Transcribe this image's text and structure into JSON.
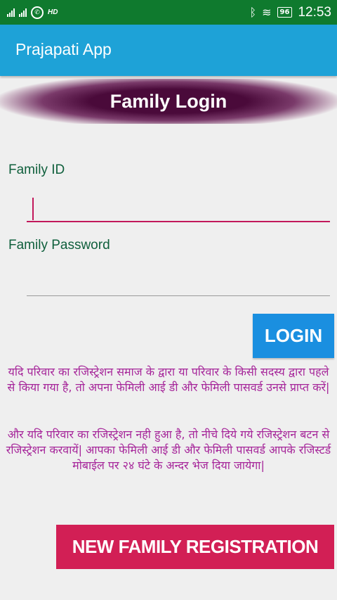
{
  "status_bar": {
    "network_label": "HD",
    "battery": "96",
    "time": "12:53"
  },
  "app_bar": {
    "title": "Prajapati App"
  },
  "banner": {
    "title": "Family Login"
  },
  "form": {
    "id_label": "Family ID",
    "id_value": "",
    "password_label": "Family Password",
    "password_value": "",
    "login_button": "LOGIN"
  },
  "info": {
    "paragraph1": "यदि परिवार का रजिस्ट्रेशन समाज के द्वारा या परिवार के किसी सदस्य द्वारा पहले से किया गया है, तो अपना फेमिली आई डी और फेमिली पासवर्ड उनसे प्राप्त करें|",
    "paragraph2": "और यदि परिवार का रजिस्ट्रेशन नही हुआ है, तो नीचे दिये गये रजिस्ट्रेशन बटन से रजिस्ट्रेशन करवायें| आपका फेमिली आई डी और फेमिली पासवर्ड आपके रजिस्टर्ड मोबाईल पर २४ घंटे के अन्दर भेज दिया जायेगा|"
  },
  "register_button": "NEW FAMILY REGISTRATION",
  "colors": {
    "status_bar": "#0f7a2e",
    "app_bar": "#1ea2d7",
    "banner": "#4a0a3a",
    "label": "#0f5f3c",
    "accent": "#c2185b",
    "login_button": "#1a8fe0",
    "info_text": "#a6269a",
    "register_button": "#d21f55"
  }
}
